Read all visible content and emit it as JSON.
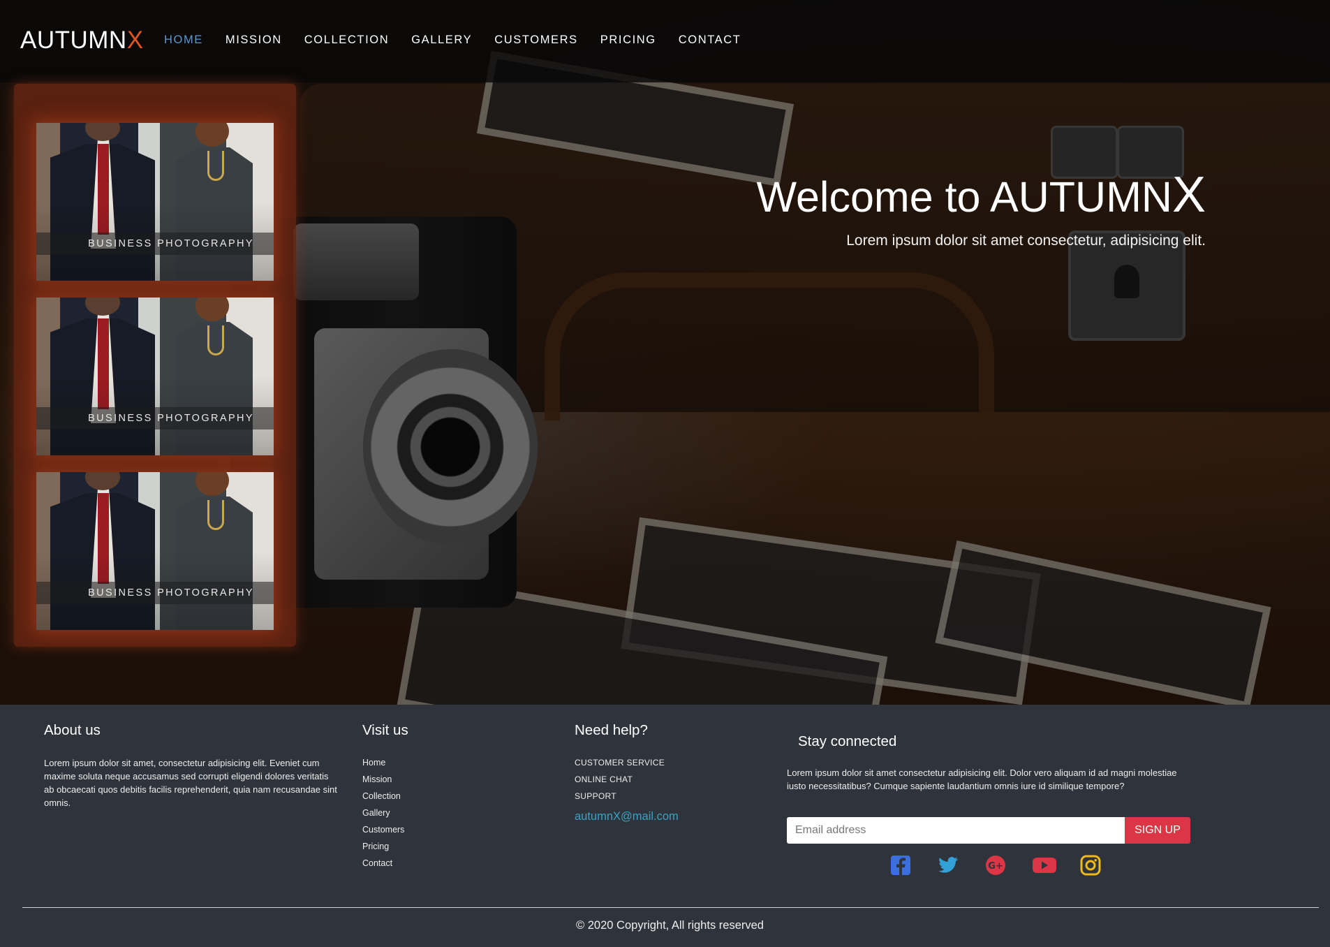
{
  "brand": {
    "name_main": "AUTUMN",
    "name_accent": "X",
    "accent_color": "#e0541f"
  },
  "nav": {
    "active_color": "#5f97cf",
    "items": [
      "HOME",
      "MISSION",
      "COLLECTION",
      "GALLERY",
      "CUSTOMERS",
      "PRICING",
      "CONTACT"
    ]
  },
  "gallery": {
    "cards": [
      {
        "caption": "BUSINESS PHOTOGRAPHY"
      },
      {
        "caption": "BUSINESS PHOTOGRAPHY"
      },
      {
        "caption": "BUSINESS PHOTOGRAPHY"
      }
    ]
  },
  "hero": {
    "title_main": "Welcome to AUTUMN",
    "title_accent": "X",
    "subtitle": "Lorem ipsum dolor sit amet consectetur, adipisicing elit."
  },
  "footer": {
    "about": {
      "heading": "About us",
      "text": "Lorem ipsum dolor sit amet, consectetur adipisicing elit. Eveniet cum maxime soluta neque accusamus sed corrupti eligendi dolores veritatis ab obcaecati quos debitis facilis reprehenderit, quia nam recusandae sint omnis."
    },
    "visit": {
      "heading": "Visit us",
      "links": [
        "Home",
        "Mission",
        "Collection",
        "Gallery",
        "Customers",
        "Pricing",
        "Contact"
      ]
    },
    "help": {
      "heading": "Need help?",
      "links": [
        "CUSTOMER SERVICE",
        "ONLINE CHAT",
        "SUPPORT"
      ],
      "email": "autumnX@mail.com",
      "email_color": "#3aa3c4"
    },
    "stay": {
      "heading": "Stay connected",
      "text": "Lorem ipsum dolor sit amet consectetur adipisicing elit. Dolor vero aliquam id ad magni molestiae iusto necessitatibus? Cumque sapiente laudantium omnis iure id similique tempore?",
      "email_placeholder": "Email address",
      "signup_label": "SIGN UP",
      "signup_color": "#dc3545"
    },
    "social": [
      {
        "icon": "facebook-icon",
        "color": "#3b6fe0"
      },
      {
        "icon": "twitter-icon",
        "color": "#31a2d8"
      },
      {
        "icon": "google-plus-icon",
        "color": "#dc3545"
      },
      {
        "icon": "youtube-icon",
        "color": "#dc3545"
      },
      {
        "icon": "instagram-icon",
        "color": "#f0b91a"
      }
    ],
    "copyright": "© 2020 Copyright, All rights reserved"
  }
}
